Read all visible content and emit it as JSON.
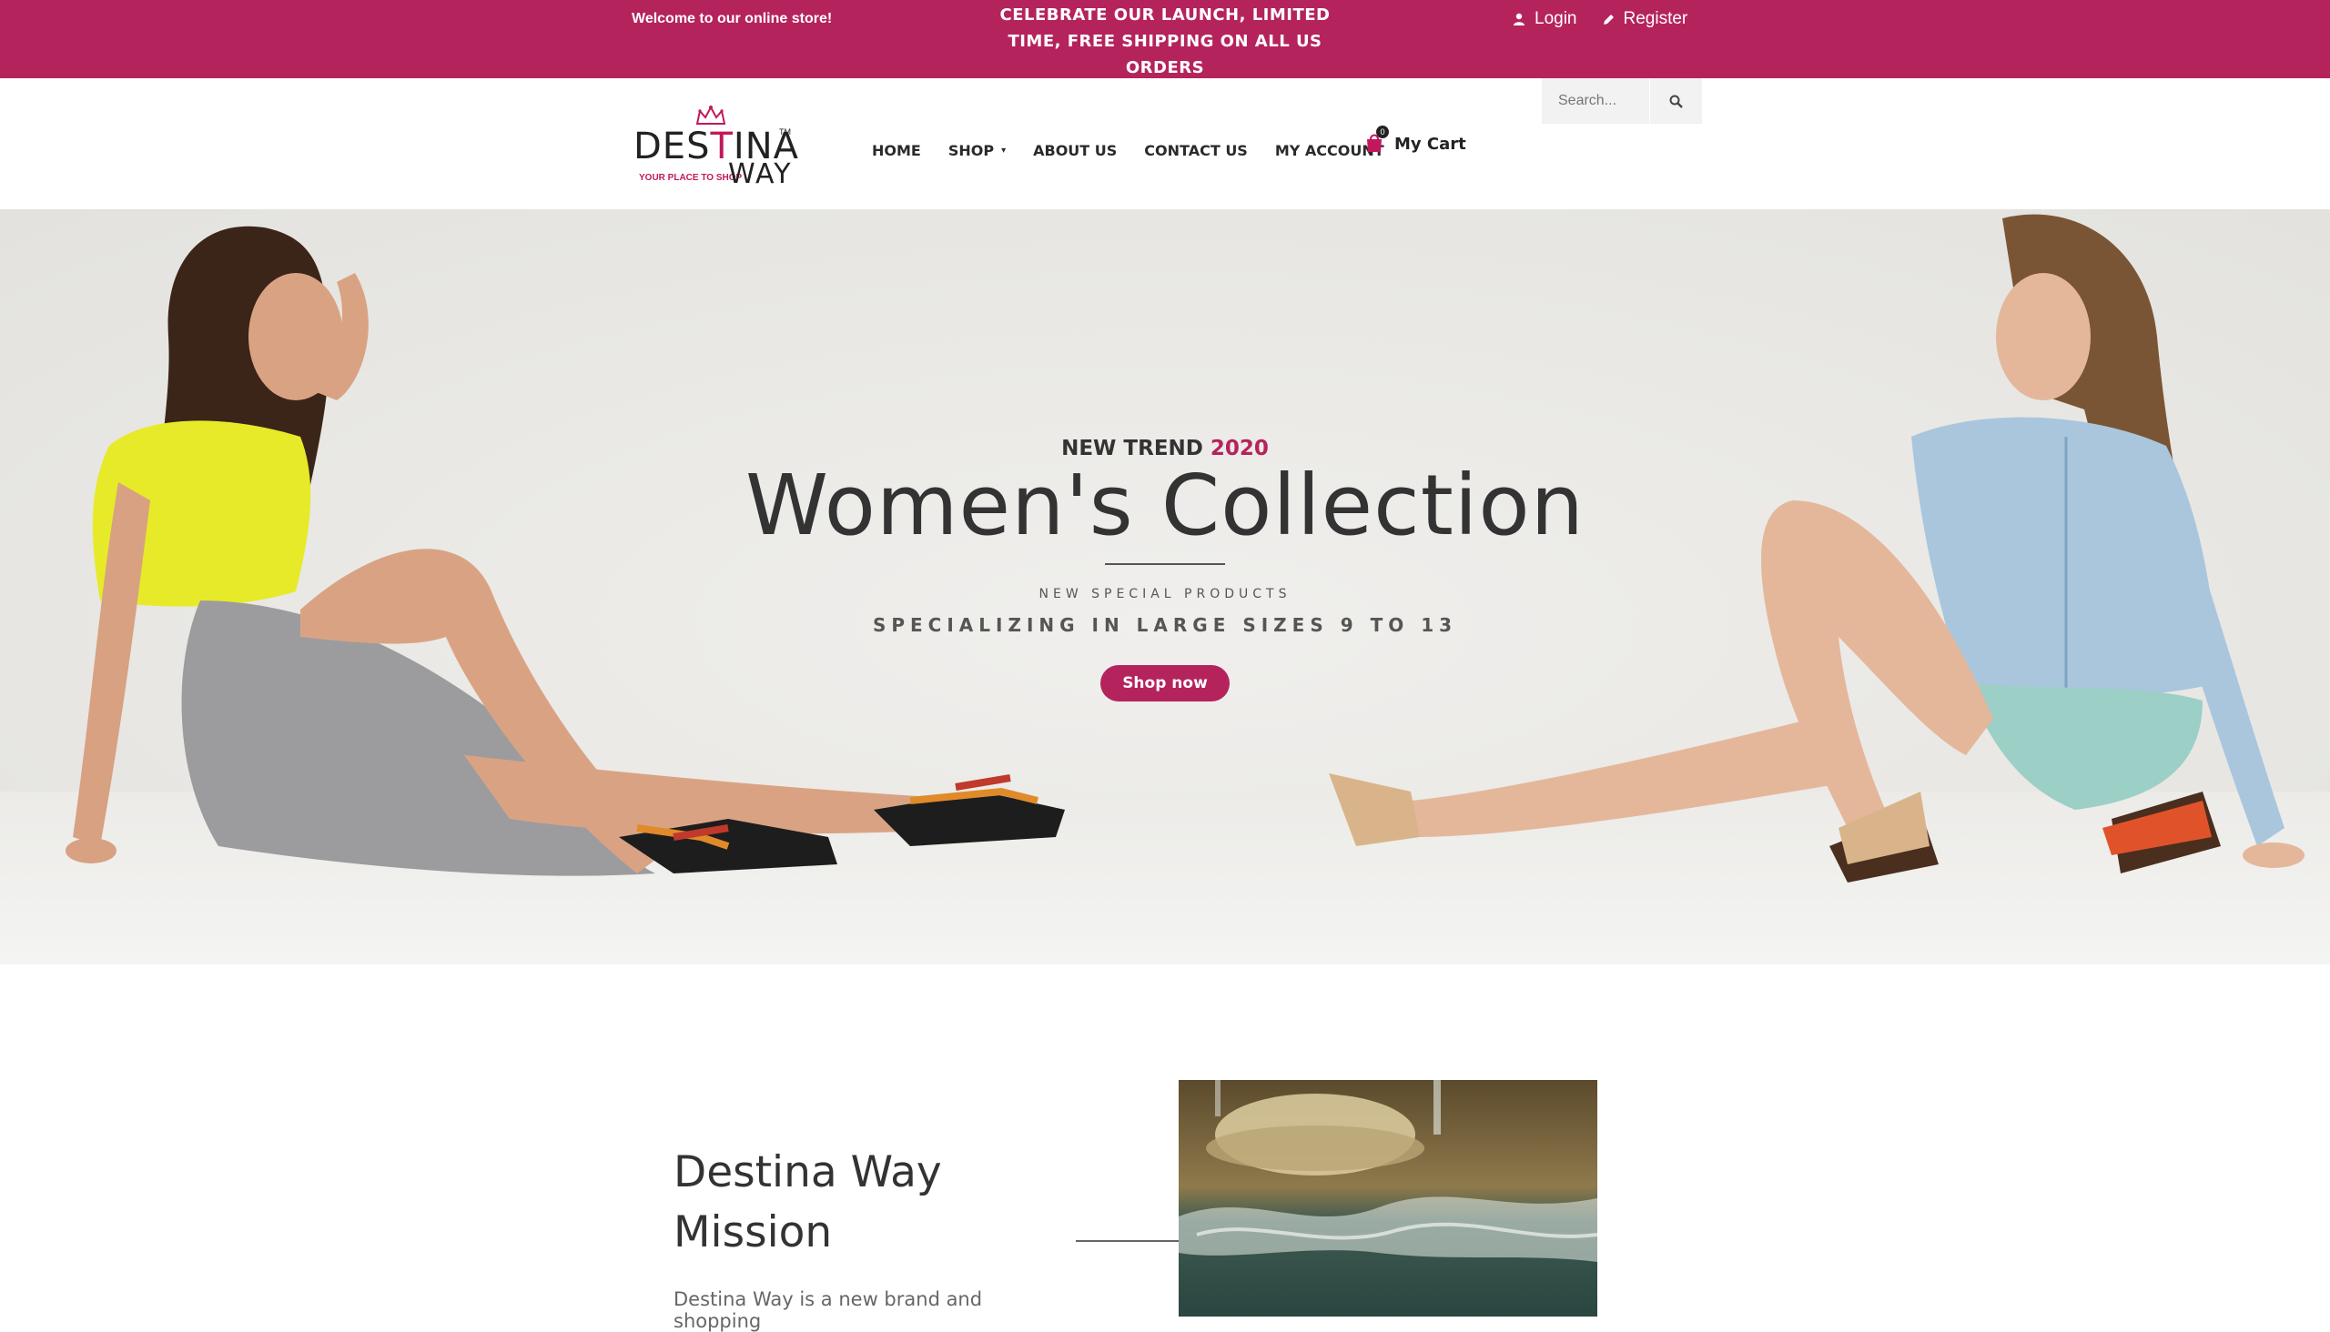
{
  "topbar": {
    "welcome": "Welcome to our online store!",
    "promo_lines": [
      "CELEBRATE OUR LAUNCH, LIMITED",
      "TIME, FREE SHIPPING ON ALL US",
      "ORDERS"
    ],
    "login": "Login",
    "register": "Register",
    "color": "#b5235d"
  },
  "header": {
    "logo": {
      "line1_a": "DES",
      "line1_b": "T",
      "line1_c": "INA",
      "tm": "TM",
      "tagline": "YOUR PLACE TO SHOP",
      "line2": "WAY"
    },
    "search": {
      "placeholder": "Search..."
    },
    "nav": [
      "HOME",
      "SHOP",
      "ABOUT US",
      "CONTACT US",
      "MY ACCOUNT"
    ],
    "cart": {
      "count": "0",
      "label": "My Cart"
    }
  },
  "hero": {
    "trend_prefix": "NEW TREND",
    "trend_year": "2020",
    "title": "Women's Collection",
    "special": "NEW SPECIAL PRODUCTS",
    "sizes": "SPECIALIZING IN LARGE SIZES 9 TO 13",
    "button": "Shop now"
  },
  "mission": {
    "title_line1": "Destina Way",
    "title_line2": "Mission",
    "text": "Destina Way is a new brand and shopping"
  },
  "icons": {
    "user": "user-icon",
    "pencil": "pencil-icon",
    "search": "search-icon",
    "cart": "cart-bag-icon",
    "crown": "crown-icon"
  },
  "accent_color": "#b5235d"
}
